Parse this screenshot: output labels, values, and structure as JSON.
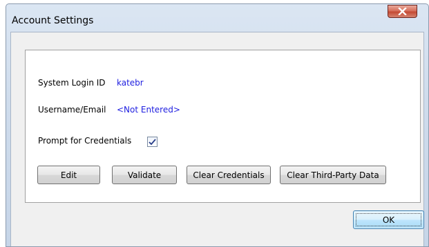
{
  "window": {
    "title": "Account Settings"
  },
  "fields": {
    "login_label": "System Login ID",
    "login_value": "katebr",
    "username_label": "Username/Email",
    "username_value": "<Not Entered>",
    "prompt_label": "Prompt for Credentials",
    "prompt_checked": true
  },
  "buttons": {
    "edit": "Edit",
    "validate": "Validate",
    "clear_credentials": "Clear Credentials",
    "clear_third_party": "Clear Third-Party Data",
    "ok": "OK"
  },
  "colors": {
    "value_text": "#2020e0",
    "close_button": "#c44a33"
  },
  "icons": {
    "close": "close-icon",
    "check": "checkmark-icon"
  }
}
